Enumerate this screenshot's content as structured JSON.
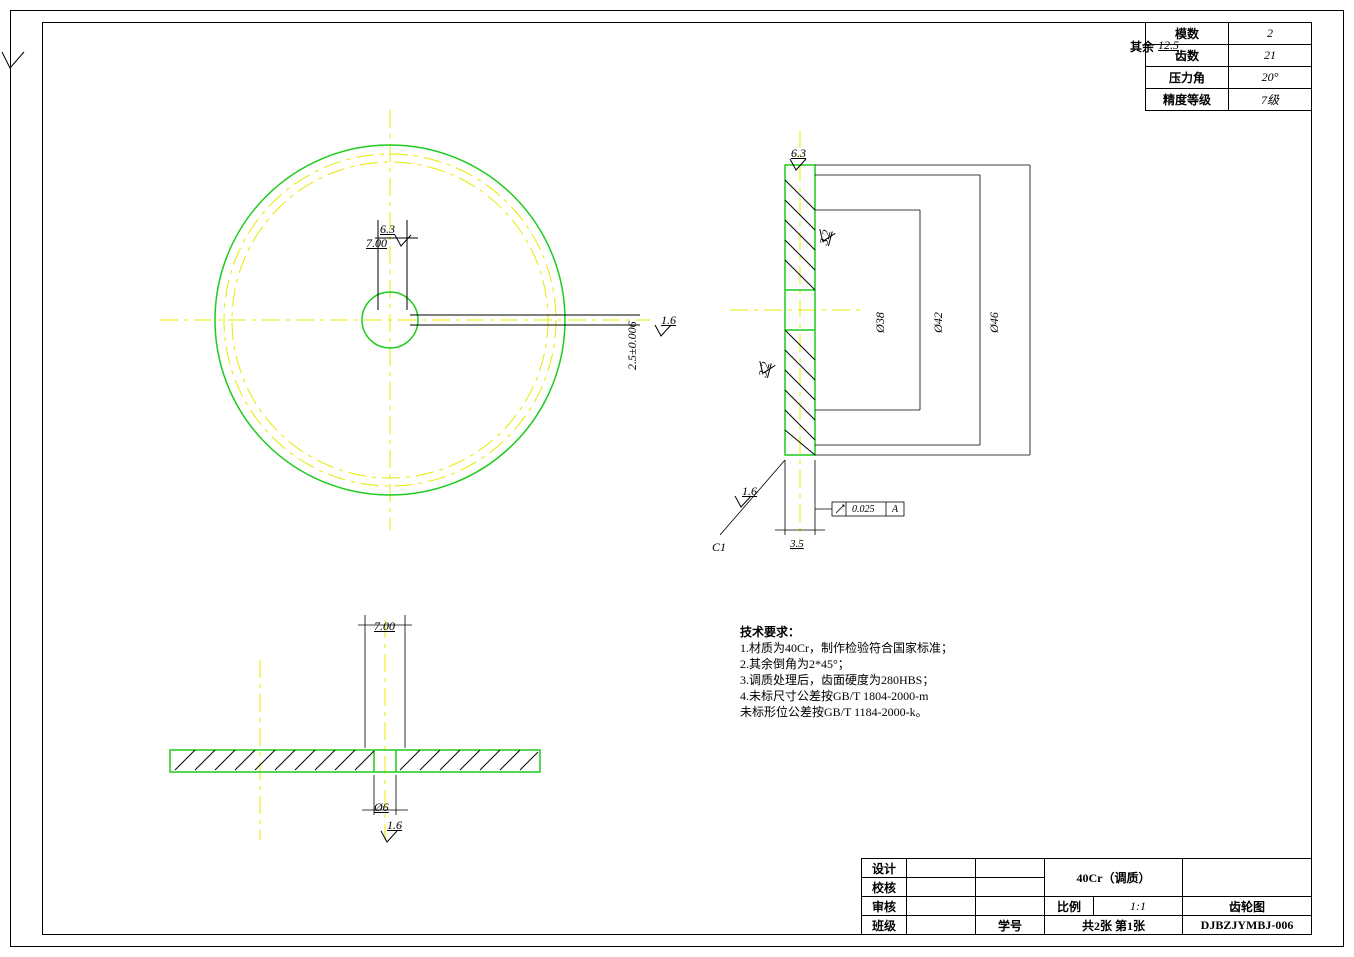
{
  "surface_marker": {
    "label": "其余",
    "value": "12.5"
  },
  "gear_params": [
    {
      "label": "模数",
      "value": "2"
    },
    {
      "label": "齿数",
      "value": "21"
    },
    {
      "label": "压力角",
      "value": "20°"
    },
    {
      "label": "精度等级",
      "value": "7级"
    }
  ],
  "top_left_view": {
    "sf_63": "6.3",
    "dim_700": "7.00",
    "sf_16": "1.6",
    "tol": "2.5±0.006"
  },
  "section_view": {
    "sf_63_top": "6.3",
    "sf_32a": "3.2",
    "sf_32b": "3.2",
    "sf_16": "1.6",
    "c1": "C1",
    "dim_35": "3.5",
    "gtol": "0.025",
    "gtol_datum": "A",
    "d38": "Ø38",
    "d42": "Ø42",
    "d46": "Ø46"
  },
  "bottom_view": {
    "dim_700": "7.00",
    "d6": "Ø6",
    "sf_16": "1.6"
  },
  "notes": {
    "title": "技术要求：",
    "l1": "1.材质为40Cr，制作检验符合国家标准；",
    "l2": "2.其余倒角为2*45°；",
    "l3": "3.调质处理后，齿面硬度为280HBS；",
    "l4": "4.未标尺寸公差按GB/T 1804-2000-m",
    "l5": "  未标形位公差按GB/T 1184-2000-k。"
  },
  "titleblock": {
    "design": "设计",
    "check": "校核",
    "review": "审核",
    "class": "班级",
    "sid": "学号",
    "material": "40Cr（调质）",
    "scale_lab": "比例",
    "scale_val": "1:1",
    "sheets": "共2张  第1张",
    "name": "齿轮图",
    "code": "DJBZJYMBJ-006"
  }
}
